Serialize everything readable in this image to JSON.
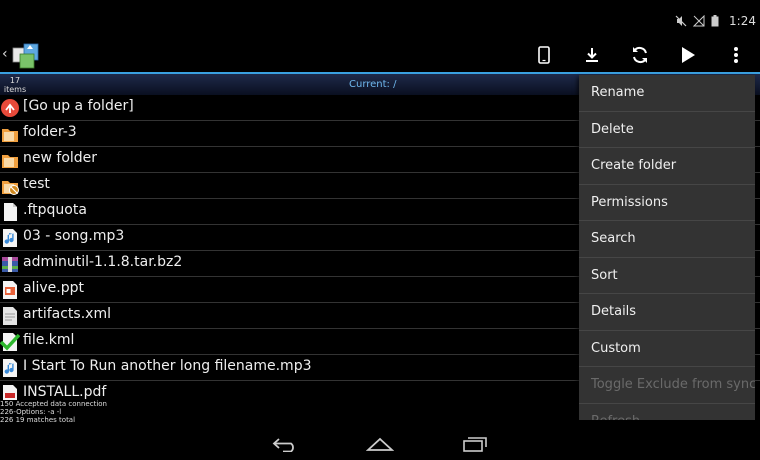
{
  "status_bar": {
    "time": "1:24"
  },
  "path_bar": {
    "item_count": "17",
    "item_count_label": "items",
    "current_path": "Current: /"
  },
  "files": [
    {
      "name": "[Go up a folder]",
      "icon": "go-up-icon"
    },
    {
      "name": "folder-3",
      "icon": "folder-icon"
    },
    {
      "name": "new folder",
      "icon": "folder-icon"
    },
    {
      "name": "test",
      "icon": "folder-excluded-icon"
    },
    {
      "name": ".ftpquota",
      "icon": "file-icon"
    },
    {
      "name": "03 - song.mp3",
      "icon": "music-file-icon"
    },
    {
      "name": "adminutil-1.1.8.tar.bz2",
      "icon": "archive-file-icon"
    },
    {
      "name": "alive.ppt",
      "icon": "presentation-file-icon"
    },
    {
      "name": "artifacts.xml",
      "icon": "xml-file-icon"
    },
    {
      "name": "file.kml",
      "icon": "synced-file-icon"
    },
    {
      "name": "I Start To Run another long filename.mp3",
      "icon": "music-file-icon"
    },
    {
      "name": "INSTALL.pdf",
      "icon": "pdf-file-icon"
    }
  ],
  "log": [
    "150 Accepted data connection",
    "226-Options: -a -l",
    "226 19 matches total"
  ],
  "menu": [
    {
      "label": "Rename",
      "enabled": true
    },
    {
      "label": "Delete",
      "enabled": true
    },
    {
      "label": "Create folder",
      "enabled": true
    },
    {
      "label": "Permissions",
      "enabled": true
    },
    {
      "label": "Search",
      "enabled": true
    },
    {
      "label": "Sort",
      "enabled": true
    },
    {
      "label": "Details",
      "enabled": true
    },
    {
      "label": "Custom",
      "enabled": true
    },
    {
      "label": "Toggle Exclude from sync",
      "enabled": false
    },
    {
      "label": "Refresh",
      "enabled": false
    }
  ],
  "colors": {
    "accent": "#3aa0e0",
    "path_text": "#6fb7ee",
    "menu_bg": "#333333"
  }
}
